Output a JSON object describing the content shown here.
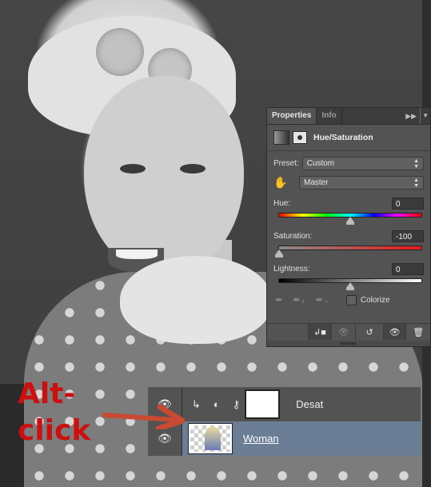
{
  "panel": {
    "tabs": [
      {
        "label": "Properties",
        "active": true
      },
      {
        "label": "Info",
        "active": false
      }
    ],
    "collapse_icon": "double-chevron-right-icon",
    "menu_icon": "panel-menu-icon",
    "adjustment_title": "Hue/Saturation",
    "preset_label": "Preset:",
    "preset_value": "Custom",
    "channel_value": "Master",
    "hue_label": "Hue:",
    "hue_value": "0",
    "saturation_label": "Saturation:",
    "saturation_value": "-100",
    "lightness_label": "Lightness:",
    "lightness_value": "0",
    "colorize_label": "Colorize",
    "colorize_checked": false,
    "slider_positions": {
      "hue": 0.5,
      "saturation": 0.0,
      "lightness": 0.5
    }
  },
  "layers": [
    {
      "name": "Desat",
      "type": "adjustment",
      "clipped": true,
      "visible": true
    },
    {
      "name": "Woman",
      "type": "pixel",
      "visible": true,
      "selected": true
    }
  ],
  "annotation": {
    "line1": "Alt-",
    "line2": "click",
    "color": "#cc0f0f"
  },
  "colors": {
    "panel_bg": "#535353",
    "selected_layer": "#6b7e96",
    "arrow": "#c84a32"
  }
}
